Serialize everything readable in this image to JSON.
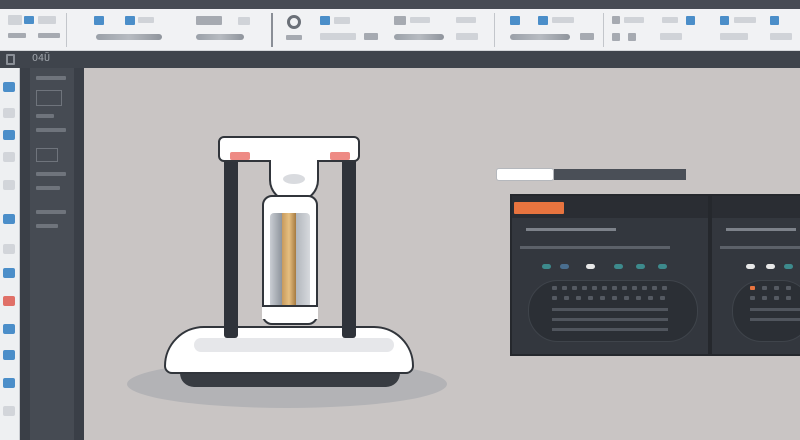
{
  "subbar": {
    "label": "O4Ũ"
  },
  "colors": {
    "accent_orange": "#e8743f",
    "toolbar_blue": "#4b8ec9",
    "pink_cap": "#ee8a84",
    "dark_panel": "#33373e",
    "canvas_bg": "#c9c5c4"
  },
  "icons": [
    "gear-icon",
    "document-icon",
    "layer-icon",
    "image-icon"
  ]
}
